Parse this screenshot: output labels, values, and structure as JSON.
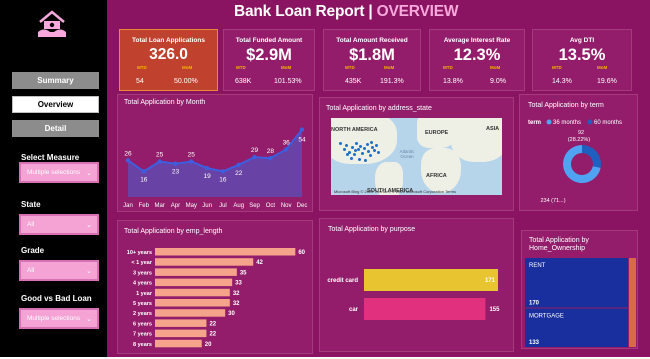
{
  "report": {
    "title_main": "Bank Loan Report | ",
    "title_highlight": "OVERVIEW"
  },
  "colors": {
    "background": "#8a1461",
    "panel": "#931d6a",
    "highlight": "#f7a8dc",
    "kpi_accent": "#f5b400",
    "bar_orange": "#f5a38a",
    "bar_yellow": "#e8c431",
    "bar_pink": "#e0307e",
    "line_blue": "#3c5ee0",
    "treemap_blue": "#1a2f9e",
    "donut_light": "#4fa3f2",
    "donut_dark": "#1f5fbf"
  },
  "sidebar": {
    "logo_icon": "house-hands-money-icon",
    "nav": [
      {
        "label": "Summary",
        "active": false
      },
      {
        "label": "Overview",
        "active": true
      },
      {
        "label": "Detail",
        "active": false
      }
    ],
    "filters": [
      {
        "label": "Select Measure",
        "value": "Multiple selections"
      },
      {
        "label": "State",
        "value": "All"
      },
      {
        "label": "Grade",
        "value": "All"
      },
      {
        "label": "Good vs Bad Loan",
        "value": "Multiple selections"
      }
    ]
  },
  "kpis": [
    {
      "title": "Total  Loan Applications",
      "value": "326.0",
      "mtd_label": "MTD",
      "mom_label": "MoM",
      "mtd": "54",
      "mom": "50.00%"
    },
    {
      "title": "Total Funded Amount",
      "value": "$2.9M",
      "mtd_label": "MTD",
      "mom_label": "MoM",
      "mtd": "638K",
      "mom": "101.53%"
    },
    {
      "title": "Total Amount Received",
      "value": "$1.8M",
      "mtd_label": "MTD",
      "mom_label": "MoM",
      "mtd": "435K",
      "mom": "191.3%"
    },
    {
      "title": "Average Interest Rate",
      "value": "12.3%",
      "mtd_label": "MTD",
      "mom_label": "MoM",
      "mtd": "13.8%",
      "mom": "9.0%"
    },
    {
      "title": "Avg DTI",
      "value": "13.5%",
      "mtd_label": "MTD",
      "mom_label": "MoM",
      "mtd": "14.3%",
      "mom": "19.6%"
    }
  ],
  "map": {
    "title": "Total Application by address_state",
    "labels": {
      "north_america": "NORTH AMERICA",
      "europe": "EUROPE",
      "asia": "ASIA",
      "africa": "AFRICA",
      "south_america": "SOUTH AMERICA",
      "atlantic": "Atlantic\nOcean"
    },
    "footer": "Microsoft Bing   © 2024 TomTom, © 2024 Microsoft Corporation  Terms"
  },
  "chart_data": [
    {
      "type": "line",
      "title": "Total Application by Month",
      "categories": [
        "Jan",
        "Feb",
        "Mar",
        "Apr",
        "May",
        "Jun",
        "Jul",
        "Aug",
        "Sep",
        "Oct",
        "Nov",
        "Dec"
      ],
      "values": [
        26,
        16,
        25,
        23,
        25,
        19,
        16,
        22,
        29,
        28,
        36,
        54
      ],
      "ylim": [
        0,
        60
      ]
    },
    {
      "type": "pie",
      "title": "Total Application by term",
      "legend_title": "term",
      "series": [
        {
          "name": "36 months",
          "value": 234,
          "label": "234 (71...)"
        },
        {
          "name": "60 months",
          "value": 92,
          "label": "92\n(28.22%)"
        }
      ]
    },
    {
      "type": "bar",
      "title": "Total Application by emp_length",
      "categories": [
        "10+ years",
        "< 1 year",
        "3 years",
        "4 years",
        "1 year",
        "5 years",
        "2 years",
        "6 years",
        "7 years",
        "8 years"
      ],
      "values": [
        60,
        42,
        35,
        33,
        32,
        32,
        30,
        22,
        22,
        20
      ],
      "xlim": [
        0,
        62
      ]
    },
    {
      "type": "bar",
      "title": "Total Application by purpose",
      "categories": [
        "credit card",
        "car"
      ],
      "values": [
        171,
        155
      ],
      "xlim": [
        0,
        171
      ]
    },
    {
      "type": "heatmap",
      "title": "Total Application by Home_Ownership",
      "categories": [
        "RENT",
        "MORTGAGE"
      ],
      "values": [
        170,
        133
      ]
    }
  ]
}
